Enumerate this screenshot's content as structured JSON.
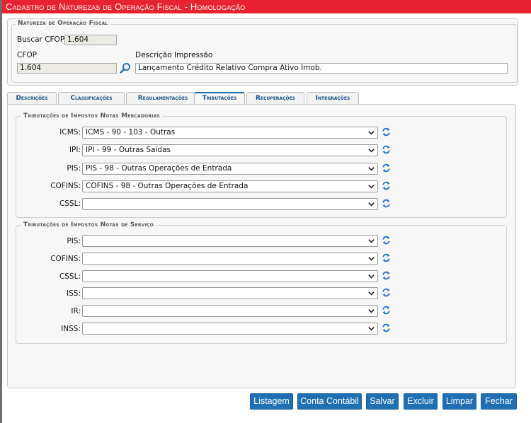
{
  "window": {
    "title": "Cadastro de Naturezas de Operação Fiscal  - Homologação"
  },
  "natureza": {
    "legend": "Natureza de Operação Fiscal",
    "buscar_label": "Buscar CFOP:",
    "buscar_value": "1.604",
    "cfop_label": "CFOP",
    "cfop_value": "1.604",
    "descricao_label": "Descrição Impressão",
    "descricao_value": "Lançamento Crédito Relativo Compra Ativo Imob."
  },
  "tabs": [
    {
      "label": "Descrições"
    },
    {
      "label": "Classificações"
    },
    {
      "label": "Regulamentações"
    },
    {
      "label": "Tributações",
      "active": true
    },
    {
      "label": "Recuperações"
    },
    {
      "label": "Integrações"
    }
  ],
  "mercadorias": {
    "legend": "Tributações de Impostos Notas Mercadorias",
    "rows": [
      {
        "label": "ICMS:",
        "value": "ICMS - 90 - 103 - Outras"
      },
      {
        "label": "IPI:",
        "value": "IPI - 99 - Outras Saídas"
      },
      {
        "label": "PIS:",
        "value": "PIS - 98 - Outras Operações de Entrada"
      },
      {
        "label": "COFINS:",
        "value": "COFINS - 98 - Outras Operações de Entrada"
      },
      {
        "label": "CSSL:",
        "value": ""
      }
    ]
  },
  "servico": {
    "legend": "Tributações de Impostos Notas de Serviço",
    "rows": [
      {
        "label": "PIS:",
        "value": ""
      },
      {
        "label": "COFINS:",
        "value": ""
      },
      {
        "label": "CSSL:",
        "value": ""
      },
      {
        "label": "ISS:",
        "value": ""
      },
      {
        "label": "IR:",
        "value": ""
      },
      {
        "label": "INSS:",
        "value": ""
      }
    ]
  },
  "buttons": {
    "listagem": "Listagem",
    "conta_contabil": "Conta Contábil",
    "salvar": "Salvar",
    "excluir": "Excluir",
    "limpar": "Limpar",
    "fechar": "Fechar"
  },
  "icons": {
    "search": "magnifier-icon",
    "refresh": "refresh-arrows-icon",
    "dropdown": "chevron-down-icon"
  },
  "colors": {
    "title_bar": "#e8232f",
    "button": "#1f6fb2",
    "tab_text": "#1a4e85",
    "refresh_icon": "#2673c7"
  }
}
